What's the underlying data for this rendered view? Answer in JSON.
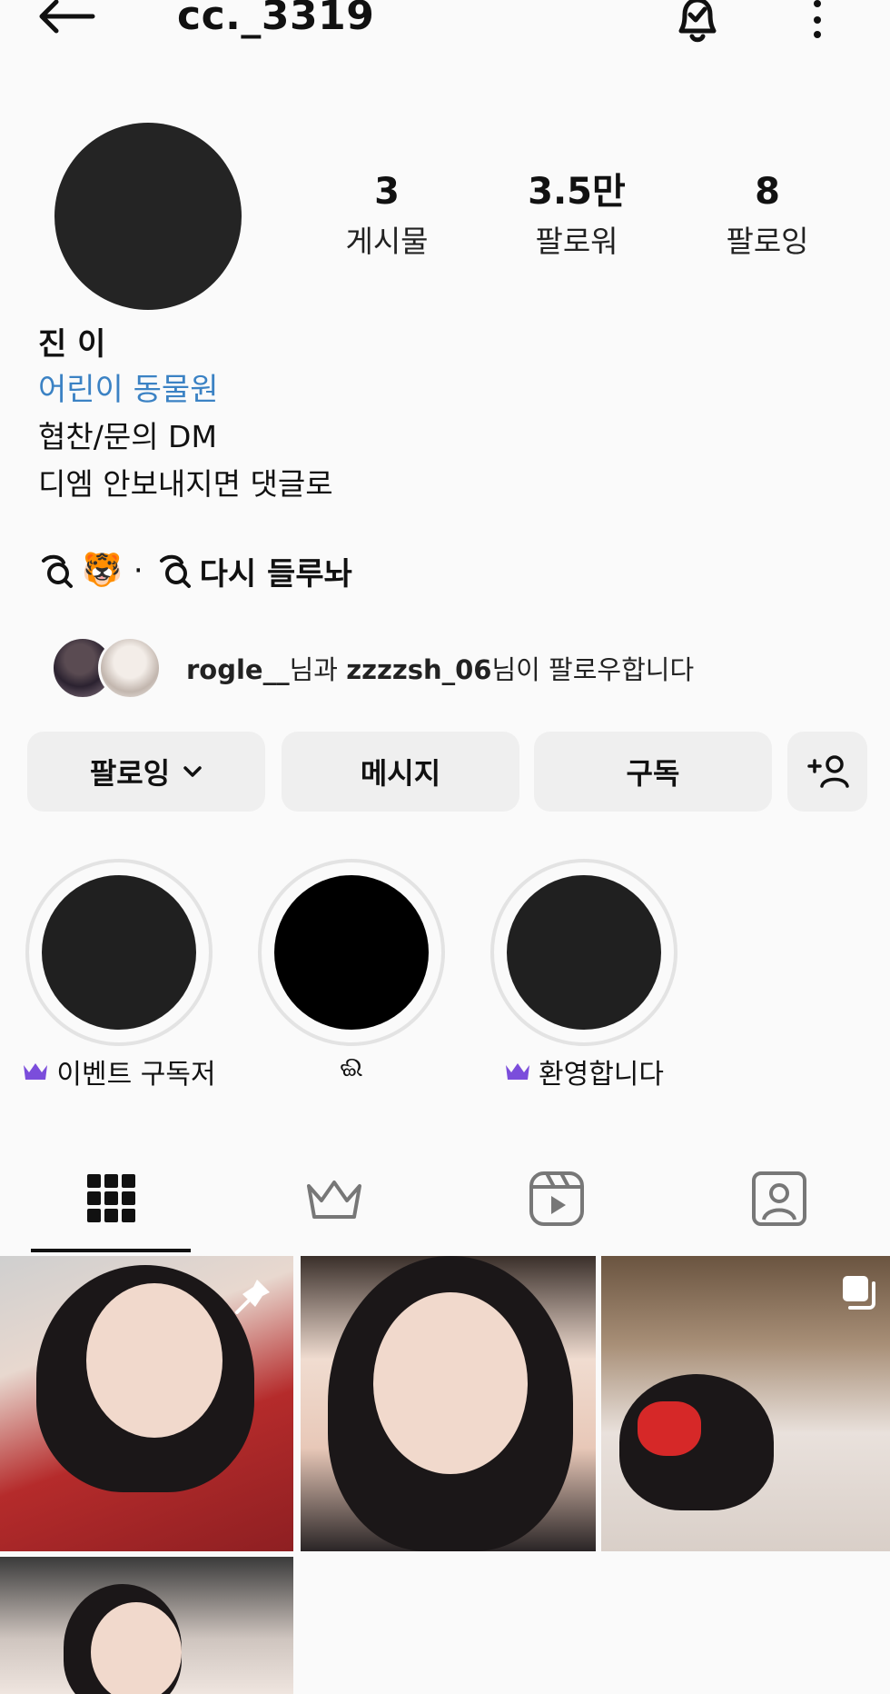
{
  "header": {
    "username": "cc._3319",
    "back_icon": "arrow-left-icon",
    "bell_icon": "bell-check-icon",
    "more_icon": "more-vertical-icon"
  },
  "stats": [
    {
      "value": "3",
      "label": "게시물"
    },
    {
      "value": "3.5만",
      "label": "팔로워"
    },
    {
      "value": "8",
      "label": "팔로잉"
    }
  ],
  "bio": {
    "name": "진 이",
    "category": "어린이 동물원",
    "line1": "협찬/문의 DM",
    "line2": "디엠 안보내지면 댓글로"
  },
  "threads": {
    "emoji": "🐯",
    "separator": "·",
    "text": "다시 들루놔"
  },
  "followed_by": {
    "user1": "rogle__",
    "connector": "님과 ",
    "user2": "zzzzsh_06",
    "suffix": "님이 팔로우합니다"
  },
  "actions": {
    "following_label": "팔로잉",
    "message_label": "메시지",
    "subscribe_label": "구독",
    "add_user_icon": "add-user-icon"
  },
  "highlights": [
    {
      "label": "이벤트 구독저",
      "crown": true
    },
    {
      "label": "ଈ",
      "crown": false
    },
    {
      "label": "환영합니다",
      "crown": true
    }
  ],
  "tabs": [
    {
      "icon": "grid-icon",
      "selected": true
    },
    {
      "icon": "crown-icon",
      "selected": false
    },
    {
      "icon": "reels-icon",
      "selected": false
    },
    {
      "icon": "tagged-icon",
      "selected": false
    }
  ],
  "colors": {
    "accent_link": "#3b82c4",
    "crown_purple": "#7b4ddb",
    "button_bg": "#efefef"
  }
}
